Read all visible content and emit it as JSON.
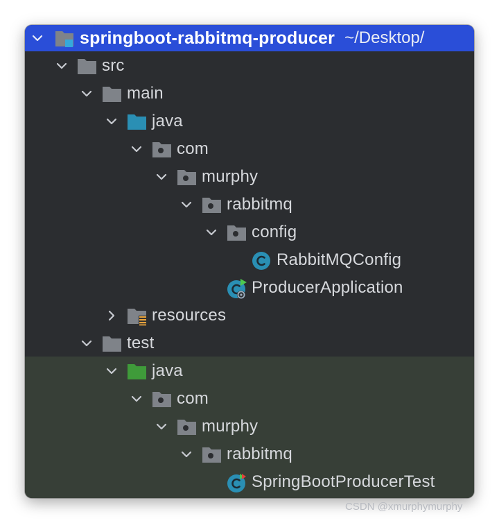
{
  "project": {
    "name": "springboot-rabbitmq-producer",
    "path": "~/Desktop/",
    "expanded": true
  },
  "tree": [
    {
      "id": "src",
      "label": "src",
      "depth": 1,
      "chevron": "down",
      "icon": "folder-icon"
    },
    {
      "id": "main",
      "label": "main",
      "depth": 2,
      "chevron": "down",
      "icon": "folder-icon"
    },
    {
      "id": "main-java",
      "label": "java",
      "depth": 3,
      "chevron": "down",
      "icon": "source-root-folder-icon"
    },
    {
      "id": "main-com",
      "label": "com",
      "depth": 4,
      "chevron": "down",
      "icon": "package-icon"
    },
    {
      "id": "main-murphy",
      "label": "murphy",
      "depth": 5,
      "chevron": "down",
      "icon": "package-icon"
    },
    {
      "id": "main-rabbitmq",
      "label": "rabbitmq",
      "depth": 6,
      "chevron": "down",
      "icon": "package-icon"
    },
    {
      "id": "config",
      "label": "config",
      "depth": 7,
      "chevron": "down",
      "icon": "package-icon"
    },
    {
      "id": "rabbitmqconfig",
      "label": "RabbitMQConfig",
      "depth": 8,
      "chevron": "none",
      "icon": "java-class-icon"
    },
    {
      "id": "producerapplication",
      "label": "ProducerApplication",
      "depth": 7,
      "chevron": "none",
      "icon": "spring-boot-class-icon"
    },
    {
      "id": "resources",
      "label": "resources",
      "depth": 3,
      "chevron": "right",
      "icon": "resources-folder-icon"
    },
    {
      "id": "test",
      "label": "test",
      "depth": 2,
      "chevron": "down",
      "icon": "folder-icon"
    },
    {
      "id": "test-java",
      "label": "java",
      "depth": 3,
      "chevron": "down",
      "icon": "test-root-folder-icon"
    },
    {
      "id": "test-com",
      "label": "com",
      "depth": 4,
      "chevron": "down",
      "icon": "package-icon"
    },
    {
      "id": "test-murphy",
      "label": "murphy",
      "depth": 5,
      "chevron": "down",
      "icon": "package-icon"
    },
    {
      "id": "test-rabbitmq",
      "label": "rabbitmq",
      "depth": 6,
      "chevron": "down",
      "icon": "package-icon"
    },
    {
      "id": "springbootproducertest",
      "label": "SpringBootProducerTest",
      "depth": 7,
      "chevron": "none",
      "icon": "test-class-icon"
    }
  ],
  "colors": {
    "background": "#2b2d30",
    "selection": "#2a4ed8",
    "test_background": "#373f37",
    "folder": "#7f8389",
    "source_root": "#2a8fb4",
    "test_root": "#3f9b3a",
    "class_circle": "#2a8fb4",
    "text": "#d6d8dc"
  },
  "watermark": "CSDN @xmurphymurphy"
}
